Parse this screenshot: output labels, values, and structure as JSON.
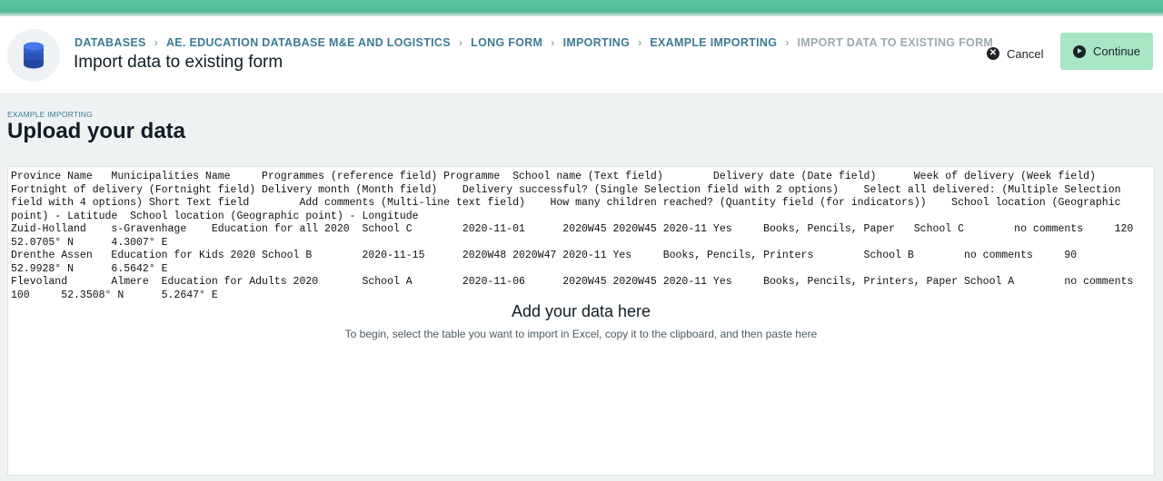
{
  "header": {
    "breadcrumb": [
      {
        "label": "DATABASES"
      },
      {
        "label": "AE. EDUCATION DATABASE M&E AND LOGISTICS"
      },
      {
        "label": "LONG FORM"
      },
      {
        "label": "IMPORTING"
      },
      {
        "label": "EXAMPLE IMPORTING"
      },
      {
        "label": "IMPORT DATA TO EXISTING FORM"
      }
    ],
    "title": "Import data to existing form",
    "icon": "database-icon"
  },
  "actions": {
    "cancel_label": "Cancel",
    "continue_label": "Continue"
  },
  "section": {
    "kicker": "EXAMPLE IMPORTING",
    "title": "Upload your data"
  },
  "paste_area": {
    "content": "Province Name   Municipalities Name     Programmes (reference field) Programme  School name (Text field)        Delivery date (Date field)      Week of delivery (Week field)   Fortnight of delivery (Fortnight field) Delivery month (Month field)    Delivery successful? (Single Selection field with 2 options)    Select all delivered: (Multiple Selection field with 4 options) Short Text field        Add comments (Multi-line text field)    How many children reached? (Quantity field (for indicators))    School location (Geographic point) - Latitude  School location (Geographic point) - Longitude\nZuid-Holland    s-Gravenhage    Education for all 2020  School C        2020-11-01      2020W45 2020W45 2020-11 Yes     Books, Pencils, Paper   School C        no comments     120     52.0705° N      4.3007° E\nDrenthe Assen   Education for Kids 2020 School B        2020-11-15      2020W48 2020W47 2020-11 Yes     Books, Pencils, Printers        School B        no comments     90      52.9928° N      6.5642° E\nFlevoland       Almere  Education for Adults 2020       School A        2020-11-06      2020W45 2020W45 2020-11 Yes     Books, Pencils, Printers, Paper School A        no comments     100     52.3508° N      5.2647° E",
    "empty_title": "Add your data here",
    "empty_hint": "To begin, select the table you want to import in Excel, copy it to the clipboard, and then paste here"
  },
  "colors": {
    "accent": "#3d7a94",
    "continue_bg": "#a8e6c6",
    "topbar": "#5cc4a2"
  }
}
